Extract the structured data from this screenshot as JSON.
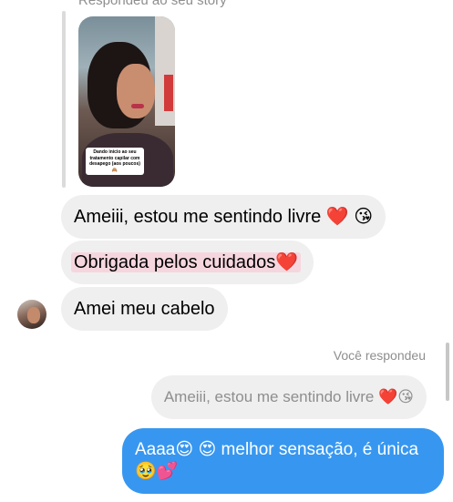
{
  "story": {
    "header_text": "Respondeu ao seu story",
    "caption": "Dando início ao seu tratamento capilar com desapego (aos poucos)🙈"
  },
  "messages_received": [
    {
      "text": "Ameiii, estou me sentindo livre ❤️ 😘"
    },
    {
      "text": "Obrigada pelos cuidados❤️"
    },
    {
      "text": "Amei meu cabelo"
    }
  ],
  "reply": {
    "label": "Você respondeu",
    "quoted_text": "Ameiii, estou me sentindo livre ❤️😘",
    "sent_text": "Aaaa😍 😍  melhor sensação, é única 🥹💕"
  },
  "colors": {
    "sent_bubble": "#3797f0",
    "received_bubble": "#efefef",
    "highlight": "#f6d6de"
  }
}
